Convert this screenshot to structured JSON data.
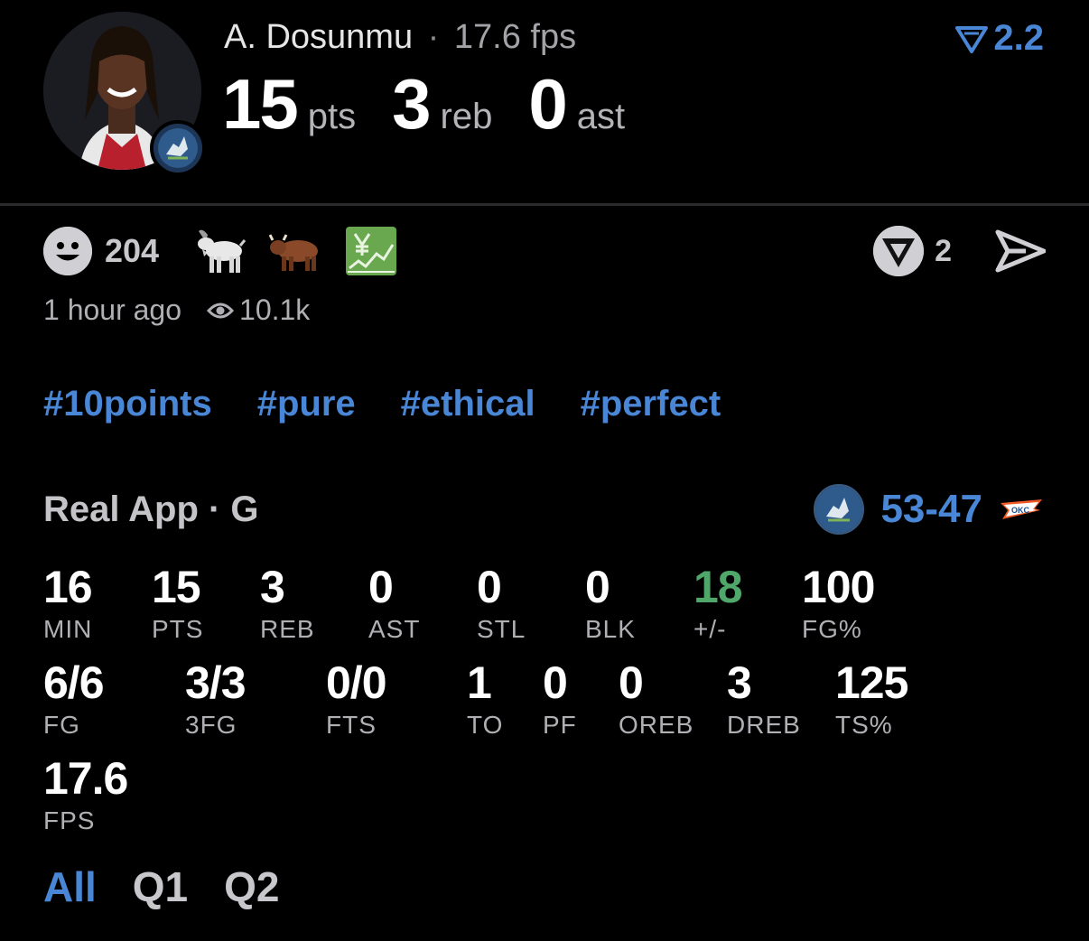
{
  "header": {
    "player_name": "A. Dosunmu",
    "separator": "·",
    "fps": "17.6 fps",
    "pts": "15",
    "pts_label": "pts",
    "reb": "3",
    "reb_label": "reb",
    "ast": "0",
    "ast_label": "ast",
    "rank_value": "2.2",
    "accent": "#4a86d6"
  },
  "reactions": {
    "count": "204",
    "items": [
      "goat-emoji",
      "bull-emoji",
      "chart-yen-emoji"
    ],
    "badge_count": "2"
  },
  "meta": {
    "time": "1 hour ago",
    "views": "10.1k"
  },
  "tags": [
    "#10points",
    "#pure",
    "#ethical",
    "#perfect"
  ],
  "game": {
    "label": "Real App · G",
    "score": "53-47",
    "opponent": "OKC"
  },
  "stats_row1": [
    {
      "v": "16",
      "l": "MIN"
    },
    {
      "v": "15",
      "l": "PTS"
    },
    {
      "v": "3",
      "l": "REB"
    },
    {
      "v": "0",
      "l": "AST"
    },
    {
      "v": "0",
      "l": "STL"
    },
    {
      "v": "0",
      "l": "BLK"
    },
    {
      "v": "18",
      "l": "+/-"
    },
    {
      "v": "100",
      "l": "FG%"
    }
  ],
  "stats_row2": [
    {
      "v": "6/6",
      "l": "FG"
    },
    {
      "v": "3/3",
      "l": "3FG"
    },
    {
      "v": "0/0",
      "l": "FTS"
    },
    {
      "v": "1",
      "l": "TO"
    },
    {
      "v": "0",
      "l": "PF"
    },
    {
      "v": "0",
      "l": "OREB"
    },
    {
      "v": "3",
      "l": "DREB"
    },
    {
      "v": "125",
      "l": "TS%"
    }
  ],
  "stats_row3": [
    {
      "v": "17.6",
      "l": "FPS"
    }
  ],
  "periods": [
    "All",
    "Q1",
    "Q2"
  ]
}
